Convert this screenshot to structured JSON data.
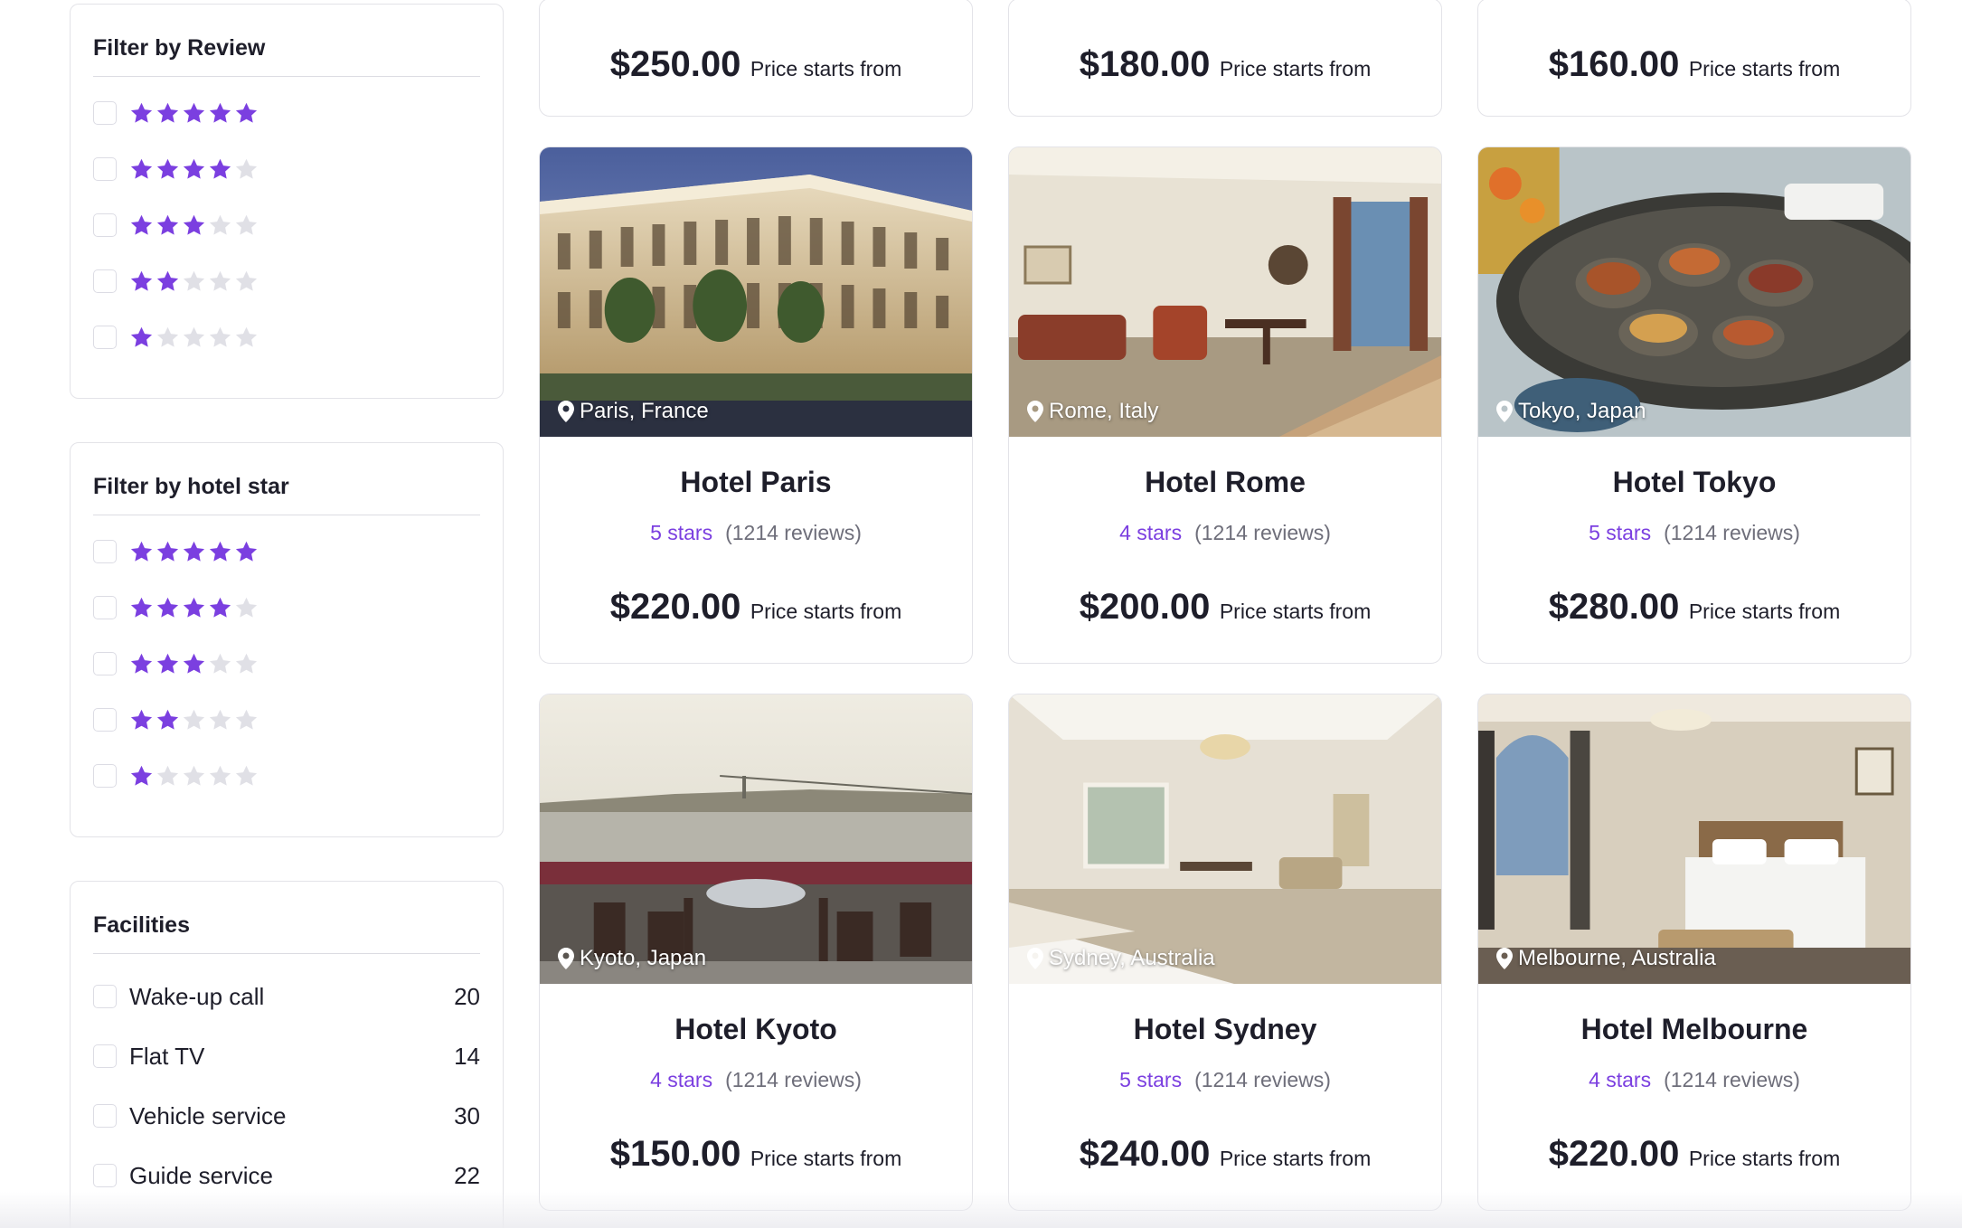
{
  "filters": {
    "review": {
      "title": "Filter by Review",
      "options": [
        {
          "stars": 5
        },
        {
          "stars": 4
        },
        {
          "stars": 3
        },
        {
          "stars": 2
        },
        {
          "stars": 1
        }
      ]
    },
    "hotel_star": {
      "title": "Filter by hotel star",
      "options": [
        {
          "stars": 5
        },
        {
          "stars": 4
        },
        {
          "stars": 3
        },
        {
          "stars": 2
        },
        {
          "stars": 1
        }
      ]
    },
    "facilities": {
      "title": "Facilities",
      "items": [
        {
          "label": "Wake-up call",
          "count": "20"
        },
        {
          "label": "Flat TV",
          "count": "14"
        },
        {
          "label": "Vehicle service",
          "count": "30"
        },
        {
          "label": "Guide service",
          "count": "22"
        }
      ]
    }
  },
  "top_row": [
    {
      "price": "$250.00",
      "note": "Price starts from"
    },
    {
      "price": "$180.00",
      "note": "Price starts from"
    },
    {
      "price": "$160.00",
      "note": "Price starts from"
    }
  ],
  "hotels": [
    {
      "name": "Hotel Paris",
      "location": "Paris, France",
      "stars_text": "5 stars",
      "reviews": "(1214 reviews)",
      "price": "$220.00",
      "note": "Price starts from",
      "photo": "palace-exterior"
    },
    {
      "name": "Hotel Rome",
      "location": "Rome, Italy",
      "stars_text": "4 stars",
      "reviews": "(1214 reviews)",
      "price": "$200.00",
      "note": "Price starts from",
      "photo": "living-room"
    },
    {
      "name": "Hotel Tokyo",
      "location": "Tokyo, Japan",
      "stars_text": "5 stars",
      "reviews": "(1214 reviews)",
      "price": "$280.00",
      "note": "Price starts from",
      "photo": "food-platter"
    },
    {
      "name": "Hotel Kyoto",
      "location": "Kyoto, Japan",
      "stars_text": "4 stars",
      "reviews": "(1214 reviews)",
      "price": "$150.00",
      "note": "Price starts from",
      "photo": "terrace-sea"
    },
    {
      "name": "Hotel Sydney",
      "location": "Sydney, Australia",
      "stars_text": "5 stars",
      "reviews": "(1214 reviews)",
      "price": "$240.00",
      "note": "Price starts from",
      "photo": "suite-room"
    },
    {
      "name": "Hotel Melbourne",
      "location": "Melbourne, Australia",
      "stars_text": "4 stars",
      "reviews": "(1214 reviews)",
      "price": "$220.00",
      "note": "Price starts from",
      "photo": "bedroom"
    }
  ],
  "colors": {
    "accent": "#7b3fe0",
    "star_off": "#e0e0e6",
    "text": "#1e1e2a",
    "muted": "#6e6e7a"
  }
}
